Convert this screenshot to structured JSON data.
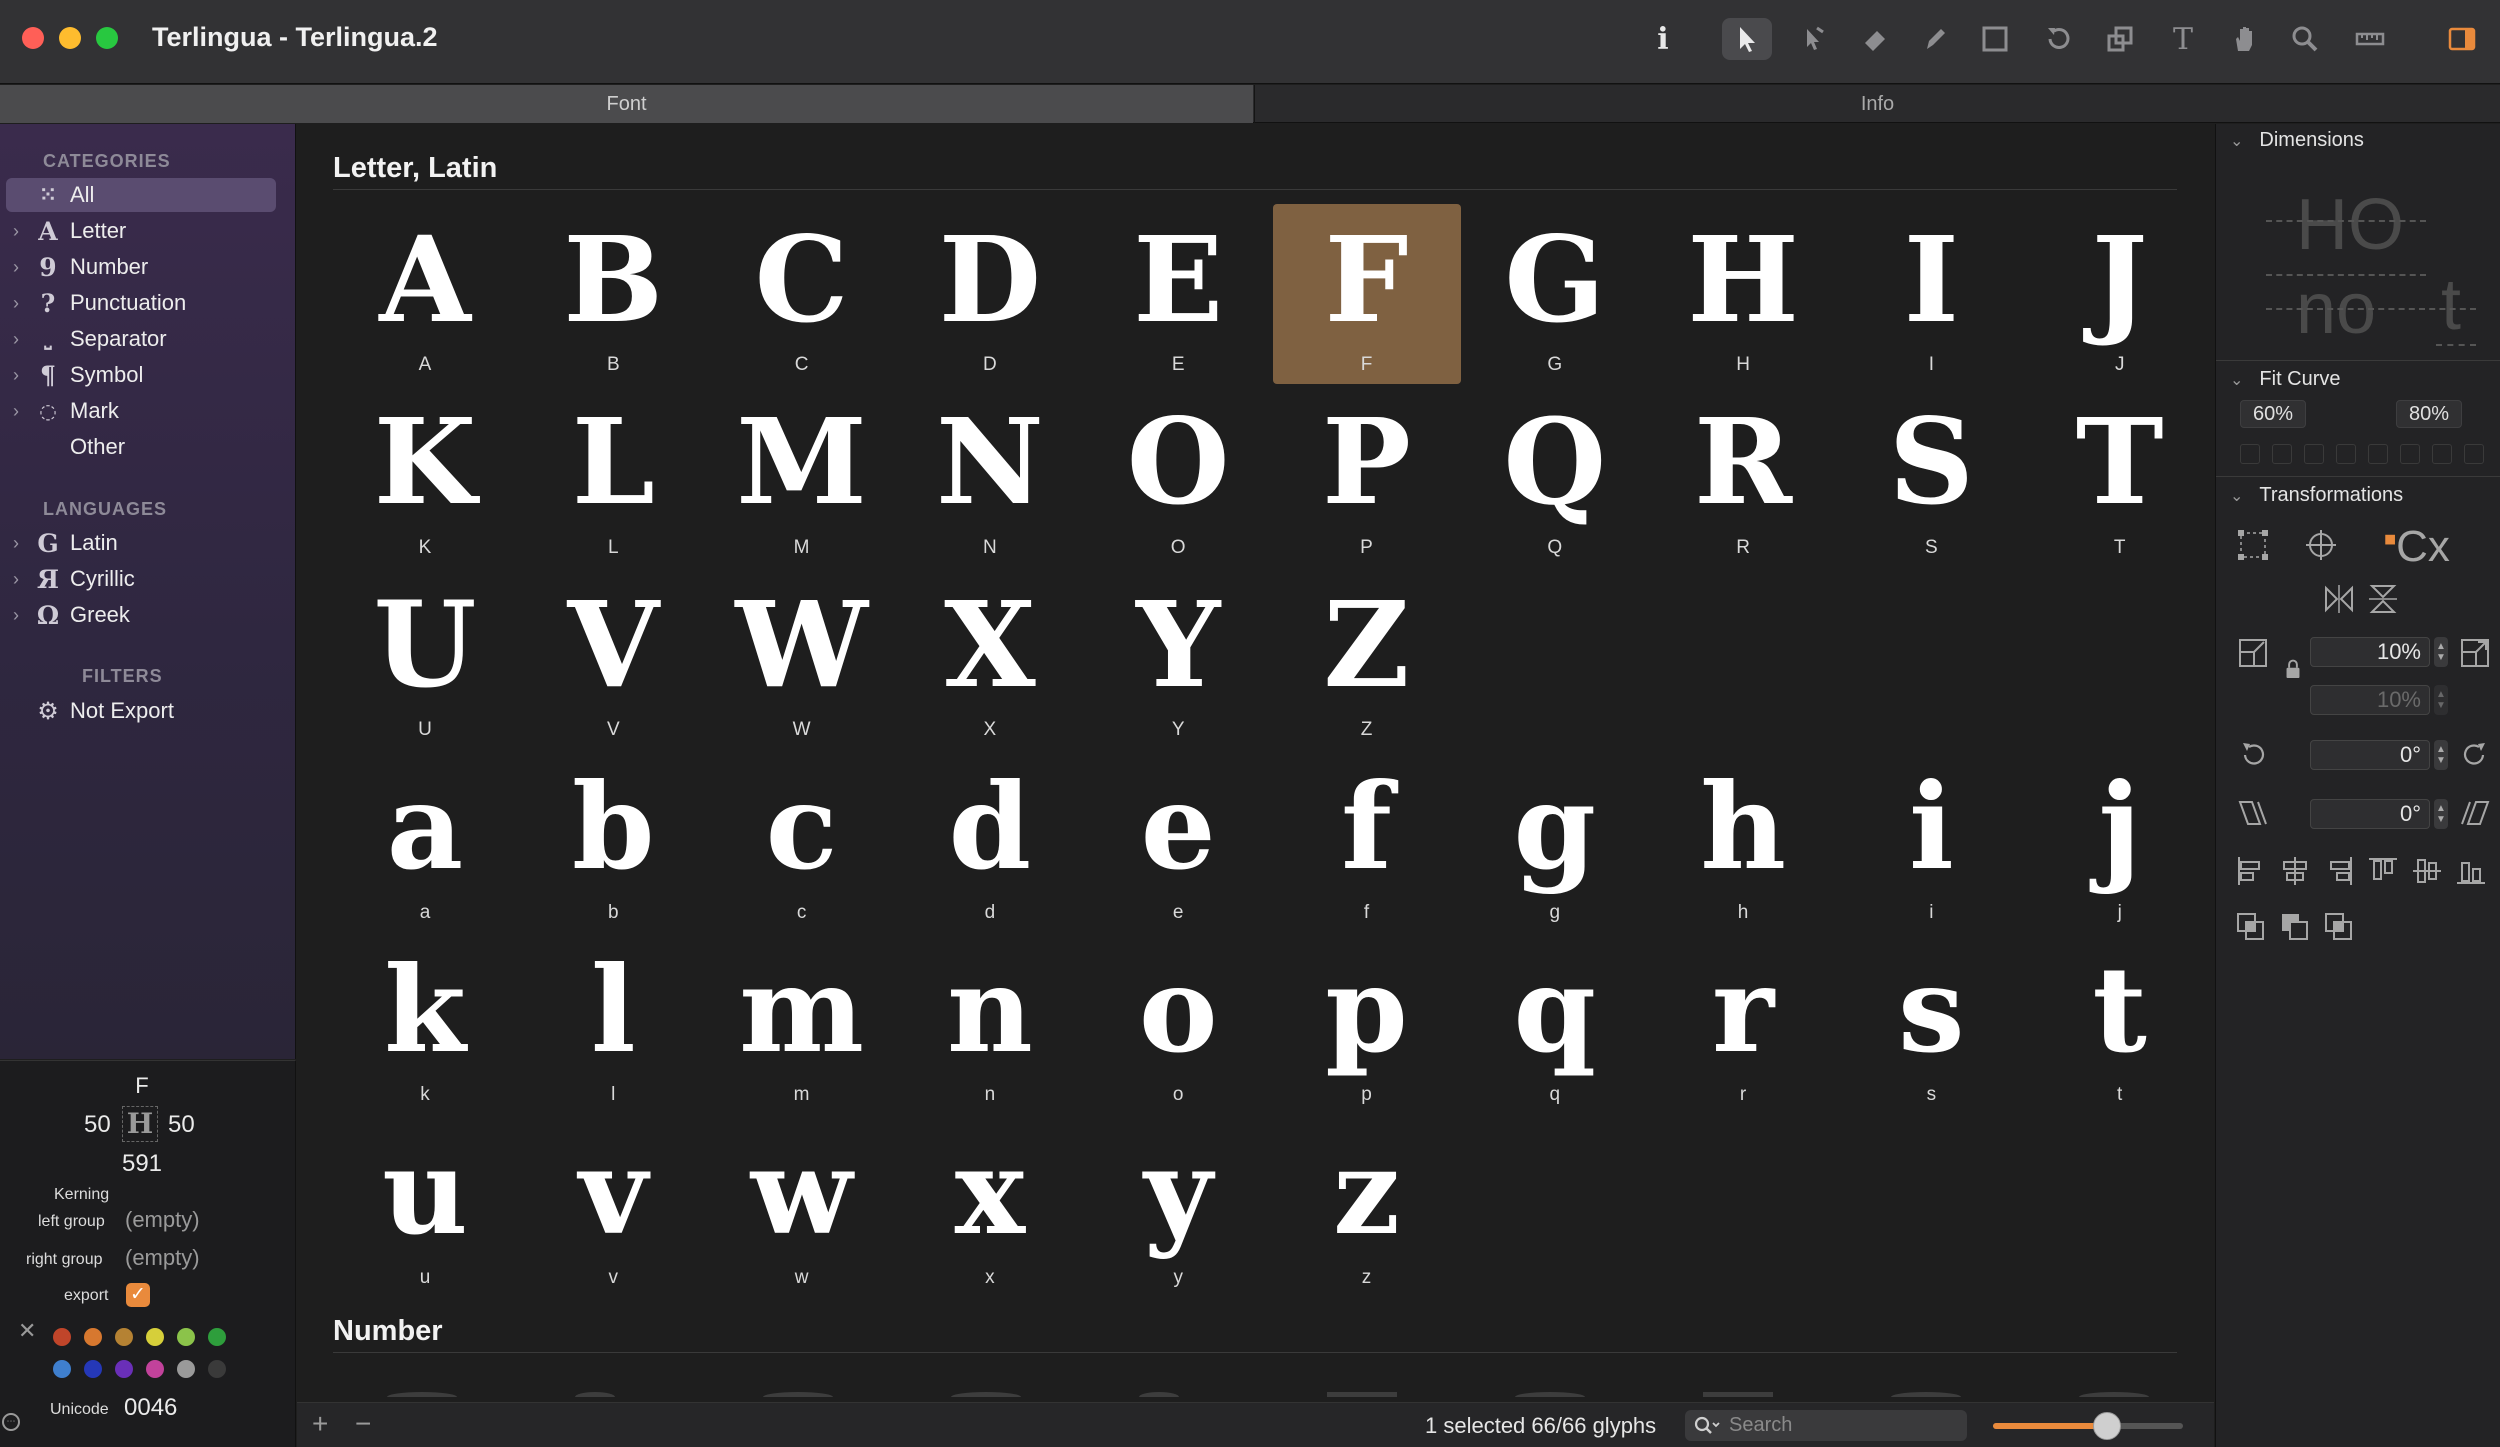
{
  "window": {
    "title": "Terlingua - Terlingua.2"
  },
  "tabs": {
    "font": "Font",
    "info": "Info"
  },
  "sidebar": {
    "categories_head": "CATEGORIES",
    "categories": [
      {
        "label": "All",
        "icon": "⸬"
      },
      {
        "label": "Letter",
        "icon": "A"
      },
      {
        "label": "Number",
        "icon": "9"
      },
      {
        "label": "Punctuation",
        "icon": "?"
      },
      {
        "label": "Separator",
        "icon": "⎵"
      },
      {
        "label": "Symbol",
        "icon": "¶"
      },
      {
        "label": "Mark",
        "icon": "◌"
      },
      {
        "label": "Other",
        "icon": ""
      }
    ],
    "languages_head": "LANGUAGES",
    "languages": [
      {
        "label": "Latin",
        "icon": "G"
      },
      {
        "label": "Cyrillic",
        "icon": "Я"
      },
      {
        "label": "Greek",
        "icon": "Ω"
      }
    ],
    "filters_head": "FILTERS",
    "filters": [
      {
        "label": "Not Export"
      }
    ]
  },
  "glyph_info": {
    "name": "F",
    "lsb": "50",
    "rsb": "50",
    "width": "591",
    "kerning_label": "Kerning",
    "left_group_label": "left group",
    "left_group_value": "(empty)",
    "right_group_label": "right group",
    "right_group_value": "(empty)",
    "export_label": "export",
    "unicode_label": "Unicode",
    "unicode_value": "0046",
    "colors": [
      "#c0452a",
      "#d7782f",
      "#b58233",
      "#d6cf3a",
      "#8bc34a",
      "#2e9e3c",
      "#3f7fce",
      "#2538b8",
      "#6a2fb8",
      "#c2429b",
      "#9a9a9a",
      "#3a3a3a"
    ]
  },
  "main": {
    "section1_title": "Letter, Latin",
    "section2_title": "Number",
    "glyphs": [
      [
        "A",
        "B",
        "C",
        "D",
        "E",
        "F",
        "G",
        "H",
        "I",
        "J"
      ],
      [
        "K",
        "L",
        "M",
        "N",
        "O",
        "P",
        "Q",
        "R",
        "S",
        "T"
      ],
      [
        "U",
        "V",
        "W",
        "X",
        "Y",
        "Z"
      ],
      [
        "a",
        "b",
        "c",
        "d",
        "e",
        "f",
        "g",
        "h",
        "i",
        "j"
      ],
      [
        "k",
        "l",
        "m",
        "n",
        "o",
        "p",
        "q",
        "r",
        "s",
        "t"
      ],
      [
        "u",
        "v",
        "w",
        "x",
        "y",
        "z"
      ]
    ],
    "selected_glyph": "F"
  },
  "bottom": {
    "add": "+",
    "remove": "−",
    "status": "1 selected 66/66 glyphs",
    "search_placeholder": "Search",
    "zoom_level": 0.6
  },
  "inspector": {
    "dimensions": "Dimensions",
    "dim_preview_1": "HO",
    "dim_preview_2": "no",
    "dim_preview_3": "t",
    "fit_curve": "Fit Curve",
    "fit_low": "60%",
    "fit_high": "80%",
    "transformations": "Transformations",
    "scale_x": "10%",
    "scale_y": "10%",
    "rotate": "0°",
    "slant": "0°",
    "cx_label": "Cx"
  }
}
